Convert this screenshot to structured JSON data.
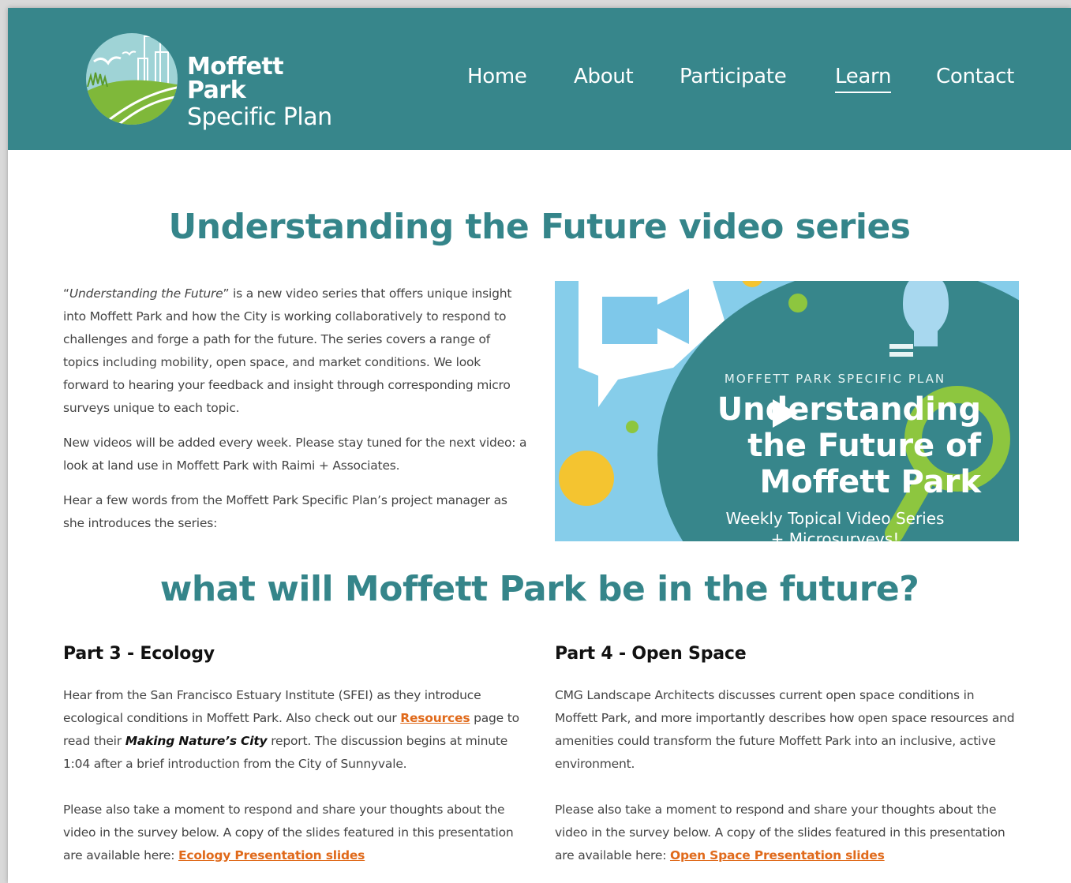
{
  "header": {
    "logo_line1": "Moffett Park",
    "logo_line2": "Specific Plan",
    "nav": [
      {
        "label": "Home"
      },
      {
        "label": "About"
      },
      {
        "label": "Participate"
      },
      {
        "label": "Learn",
        "active": true
      },
      {
        "label": "Contact"
      }
    ],
    "bg_color": "#37868b"
  },
  "section1": {
    "title": "Understanding the Future video series",
    "intro_p1_open_quote": "“",
    "intro_p1_title": "Understanding the Future",
    "intro_p1_rest": "”  is a new video series that offers unique insight into Moffett Park and how the City is working collaboratively to respond to challenges and forge a path for the future.  The series covers a range of topics including mobility, open space, and market conditions. We look forward to hearing your feedback and insight through corresponding micro surveys unique to each topic.",
    "intro_p2": "New videos will be added every week. Please stay tuned for the next video: a look at land use in Moffett Park with Raimi + Associates.",
    "intro_p3": "Hear a few words from the Moffett Park Specific Plan’s project manager as she introduces the series:"
  },
  "video": {
    "kicker": "MOFFETT PARK SPECIFIC PLAN",
    "title_line1": "Understanding",
    "title_line2": "the Future of",
    "title_line3": "Moffett Park",
    "subtitle": "Weekly Topical Video Series",
    "subtitle2": "+ Microsurveys!",
    "play_icon": "play-icon"
  },
  "section2": {
    "title": "what will Moffett Park be in the future?"
  },
  "part3": {
    "heading": "Part 3 -  Ecology",
    "p1_a": "Hear from the San Francisco Estuary Institute (SFEI) as they introduce ecological conditions in Moffett Park. Also check out our ",
    "p1_link": "Resources",
    "p1_b": " page to read their ",
    "p1_bold": "Making Nature’s City",
    "p1_c": " report. The discussion begins at minute 1:04 after a brief introduction from the City of Sunnyvale.",
    "p2_a": "Please also take a moment to respond and share your thoughts about the video in the survey below. A copy of the slides featured in this presentation are available here: ",
    "p2_link": "Ecology Presentation slides"
  },
  "part4": {
    "heading": "Part 4 -  Open Space",
    "p1": "CMG Landscape Architects discusses current open space conditions in Moffett Park, and more importantly describes how open space resources and amenities could transform the future Moffett Park into an inclusive, active environment.",
    "p2_a": "Please also take a moment to respond and share your thoughts about the video in the survey below. A copy of the slides featured in this presentation are available here: ",
    "p2_link": "Open Space Presentation slides"
  },
  "colors": {
    "accent": "#35858a",
    "link": "#e06a1b"
  }
}
